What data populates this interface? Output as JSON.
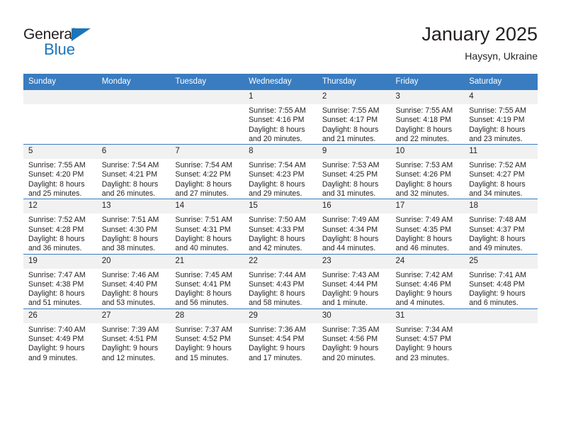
{
  "logo": {
    "text_top": "General",
    "text_bottom": "Blue",
    "accent_color": "#1b75bb",
    "triangle_icon": "triangle-icon"
  },
  "header": {
    "title": "January 2025",
    "subtitle": "Haysyn, Ukraine"
  },
  "theme": {
    "header_blue": "#3a7cc0",
    "daynum_gray": "#f1f1f1",
    "text": "#231f20"
  },
  "weekday_headers": [
    "Sunday",
    "Monday",
    "Tuesday",
    "Wednesday",
    "Thursday",
    "Friday",
    "Saturday"
  ],
  "weeks": [
    [
      {
        "day": "",
        "blank": true,
        "sunrise": "",
        "sunset": "",
        "daylight_line1": "",
        "daylight_line2": ""
      },
      {
        "day": "",
        "blank": true,
        "sunrise": "",
        "sunset": "",
        "daylight_line1": "",
        "daylight_line2": ""
      },
      {
        "day": "",
        "blank": true,
        "sunrise": "",
        "sunset": "",
        "daylight_line1": "",
        "daylight_line2": ""
      },
      {
        "day": "1",
        "sunrise": "Sunrise: 7:55 AM",
        "sunset": "Sunset: 4:16 PM",
        "daylight_line1": "Daylight: 8 hours",
        "daylight_line2": "and 20 minutes."
      },
      {
        "day": "2",
        "sunrise": "Sunrise: 7:55 AM",
        "sunset": "Sunset: 4:17 PM",
        "daylight_line1": "Daylight: 8 hours",
        "daylight_line2": "and 21 minutes."
      },
      {
        "day": "3",
        "sunrise": "Sunrise: 7:55 AM",
        "sunset": "Sunset: 4:18 PM",
        "daylight_line1": "Daylight: 8 hours",
        "daylight_line2": "and 22 minutes."
      },
      {
        "day": "4",
        "sunrise": "Sunrise: 7:55 AM",
        "sunset": "Sunset: 4:19 PM",
        "daylight_line1": "Daylight: 8 hours",
        "daylight_line2": "and 23 minutes."
      }
    ],
    [
      {
        "day": "5",
        "sunrise": "Sunrise: 7:55 AM",
        "sunset": "Sunset: 4:20 PM",
        "daylight_line1": "Daylight: 8 hours",
        "daylight_line2": "and 25 minutes."
      },
      {
        "day": "6",
        "sunrise": "Sunrise: 7:54 AM",
        "sunset": "Sunset: 4:21 PM",
        "daylight_line1": "Daylight: 8 hours",
        "daylight_line2": "and 26 minutes."
      },
      {
        "day": "7",
        "sunrise": "Sunrise: 7:54 AM",
        "sunset": "Sunset: 4:22 PM",
        "daylight_line1": "Daylight: 8 hours",
        "daylight_line2": "and 27 minutes."
      },
      {
        "day": "8",
        "sunrise": "Sunrise: 7:54 AM",
        "sunset": "Sunset: 4:23 PM",
        "daylight_line1": "Daylight: 8 hours",
        "daylight_line2": "and 29 minutes."
      },
      {
        "day": "9",
        "sunrise": "Sunrise: 7:53 AM",
        "sunset": "Sunset: 4:25 PM",
        "daylight_line1": "Daylight: 8 hours",
        "daylight_line2": "and 31 minutes."
      },
      {
        "day": "10",
        "sunrise": "Sunrise: 7:53 AM",
        "sunset": "Sunset: 4:26 PM",
        "daylight_line1": "Daylight: 8 hours",
        "daylight_line2": "and 32 minutes."
      },
      {
        "day": "11",
        "sunrise": "Sunrise: 7:52 AM",
        "sunset": "Sunset: 4:27 PM",
        "daylight_line1": "Daylight: 8 hours",
        "daylight_line2": "and 34 minutes."
      }
    ],
    [
      {
        "day": "12",
        "sunrise": "Sunrise: 7:52 AM",
        "sunset": "Sunset: 4:28 PM",
        "daylight_line1": "Daylight: 8 hours",
        "daylight_line2": "and 36 minutes."
      },
      {
        "day": "13",
        "sunrise": "Sunrise: 7:51 AM",
        "sunset": "Sunset: 4:30 PM",
        "daylight_line1": "Daylight: 8 hours",
        "daylight_line2": "and 38 minutes."
      },
      {
        "day": "14",
        "sunrise": "Sunrise: 7:51 AM",
        "sunset": "Sunset: 4:31 PM",
        "daylight_line1": "Daylight: 8 hours",
        "daylight_line2": "and 40 minutes."
      },
      {
        "day": "15",
        "sunrise": "Sunrise: 7:50 AM",
        "sunset": "Sunset: 4:33 PM",
        "daylight_line1": "Daylight: 8 hours",
        "daylight_line2": "and 42 minutes."
      },
      {
        "day": "16",
        "sunrise": "Sunrise: 7:49 AM",
        "sunset": "Sunset: 4:34 PM",
        "daylight_line1": "Daylight: 8 hours",
        "daylight_line2": "and 44 minutes."
      },
      {
        "day": "17",
        "sunrise": "Sunrise: 7:49 AM",
        "sunset": "Sunset: 4:35 PM",
        "daylight_line1": "Daylight: 8 hours",
        "daylight_line2": "and 46 minutes."
      },
      {
        "day": "18",
        "sunrise": "Sunrise: 7:48 AM",
        "sunset": "Sunset: 4:37 PM",
        "daylight_line1": "Daylight: 8 hours",
        "daylight_line2": "and 49 minutes."
      }
    ],
    [
      {
        "day": "19",
        "sunrise": "Sunrise: 7:47 AM",
        "sunset": "Sunset: 4:38 PM",
        "daylight_line1": "Daylight: 8 hours",
        "daylight_line2": "and 51 minutes."
      },
      {
        "day": "20",
        "sunrise": "Sunrise: 7:46 AM",
        "sunset": "Sunset: 4:40 PM",
        "daylight_line1": "Daylight: 8 hours",
        "daylight_line2": "and 53 minutes."
      },
      {
        "day": "21",
        "sunrise": "Sunrise: 7:45 AM",
        "sunset": "Sunset: 4:41 PM",
        "daylight_line1": "Daylight: 8 hours",
        "daylight_line2": "and 56 minutes."
      },
      {
        "day": "22",
        "sunrise": "Sunrise: 7:44 AM",
        "sunset": "Sunset: 4:43 PM",
        "daylight_line1": "Daylight: 8 hours",
        "daylight_line2": "and 58 minutes."
      },
      {
        "day": "23",
        "sunrise": "Sunrise: 7:43 AM",
        "sunset": "Sunset: 4:44 PM",
        "daylight_line1": "Daylight: 9 hours",
        "daylight_line2": "and 1 minute."
      },
      {
        "day": "24",
        "sunrise": "Sunrise: 7:42 AM",
        "sunset": "Sunset: 4:46 PM",
        "daylight_line1": "Daylight: 9 hours",
        "daylight_line2": "and 4 minutes."
      },
      {
        "day": "25",
        "sunrise": "Sunrise: 7:41 AM",
        "sunset": "Sunset: 4:48 PM",
        "daylight_line1": "Daylight: 9 hours",
        "daylight_line2": "and 6 minutes."
      }
    ],
    [
      {
        "day": "26",
        "sunrise": "Sunrise: 7:40 AM",
        "sunset": "Sunset: 4:49 PM",
        "daylight_line1": "Daylight: 9 hours",
        "daylight_line2": "and 9 minutes."
      },
      {
        "day": "27",
        "sunrise": "Sunrise: 7:39 AM",
        "sunset": "Sunset: 4:51 PM",
        "daylight_line1": "Daylight: 9 hours",
        "daylight_line2": "and 12 minutes."
      },
      {
        "day": "28",
        "sunrise": "Sunrise: 7:37 AM",
        "sunset": "Sunset: 4:52 PM",
        "daylight_line1": "Daylight: 9 hours",
        "daylight_line2": "and 15 minutes."
      },
      {
        "day": "29",
        "sunrise": "Sunrise: 7:36 AM",
        "sunset": "Sunset: 4:54 PM",
        "daylight_line1": "Daylight: 9 hours",
        "daylight_line2": "and 17 minutes."
      },
      {
        "day": "30",
        "sunrise": "Sunrise: 7:35 AM",
        "sunset": "Sunset: 4:56 PM",
        "daylight_line1": "Daylight: 9 hours",
        "daylight_line2": "and 20 minutes."
      },
      {
        "day": "31",
        "sunrise": "Sunrise: 7:34 AM",
        "sunset": "Sunset: 4:57 PM",
        "daylight_line1": "Daylight: 9 hours",
        "daylight_line2": "and 23 minutes."
      },
      {
        "day": "",
        "blank": true,
        "sunrise": "",
        "sunset": "",
        "daylight_line1": "",
        "daylight_line2": ""
      }
    ]
  ]
}
